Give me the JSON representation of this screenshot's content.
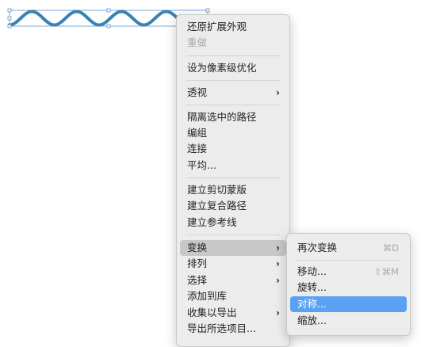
{
  "colors": {
    "wave_stroke": "#3b82b0",
    "menu_background": "#ececec",
    "hover_background": "#c8c8c8",
    "selection_background": "#5aa2f1"
  },
  "context_menu": {
    "items": [
      {
        "label": "还原扩展外观"
      },
      {
        "label": "重做",
        "disabled": true
      },
      {
        "label": "设为像素级优化"
      },
      {
        "label": "透视",
        "submenu_icon": "chevron-right-icon"
      },
      {
        "label": "隔离选中的路径"
      },
      {
        "label": "编组"
      },
      {
        "label": "连接"
      },
      {
        "label": "平均..."
      },
      {
        "label": "建立剪切蒙版"
      },
      {
        "label": "建立复合路径"
      },
      {
        "label": "建立参考线"
      },
      {
        "label": "变换",
        "submenu_icon": "chevron-right-icon",
        "state": "hover"
      },
      {
        "label": "排列",
        "submenu_icon": "chevron-right-icon"
      },
      {
        "label": "选择",
        "submenu_icon": "chevron-right-icon"
      },
      {
        "label": "添加到库"
      },
      {
        "label": "收集以导出",
        "submenu_icon": "chevron-right-icon"
      },
      {
        "label": "导出所选项目..."
      }
    ]
  },
  "transform_submenu": {
    "items": [
      {
        "label": "再次变换",
        "shortcut": "⌘D"
      },
      {
        "label": "移动...",
        "shortcut": "⇧⌘M"
      },
      {
        "label": "旋转..."
      },
      {
        "label": "对称...",
        "state": "selected"
      },
      {
        "label": "缩放..."
      }
    ]
  }
}
